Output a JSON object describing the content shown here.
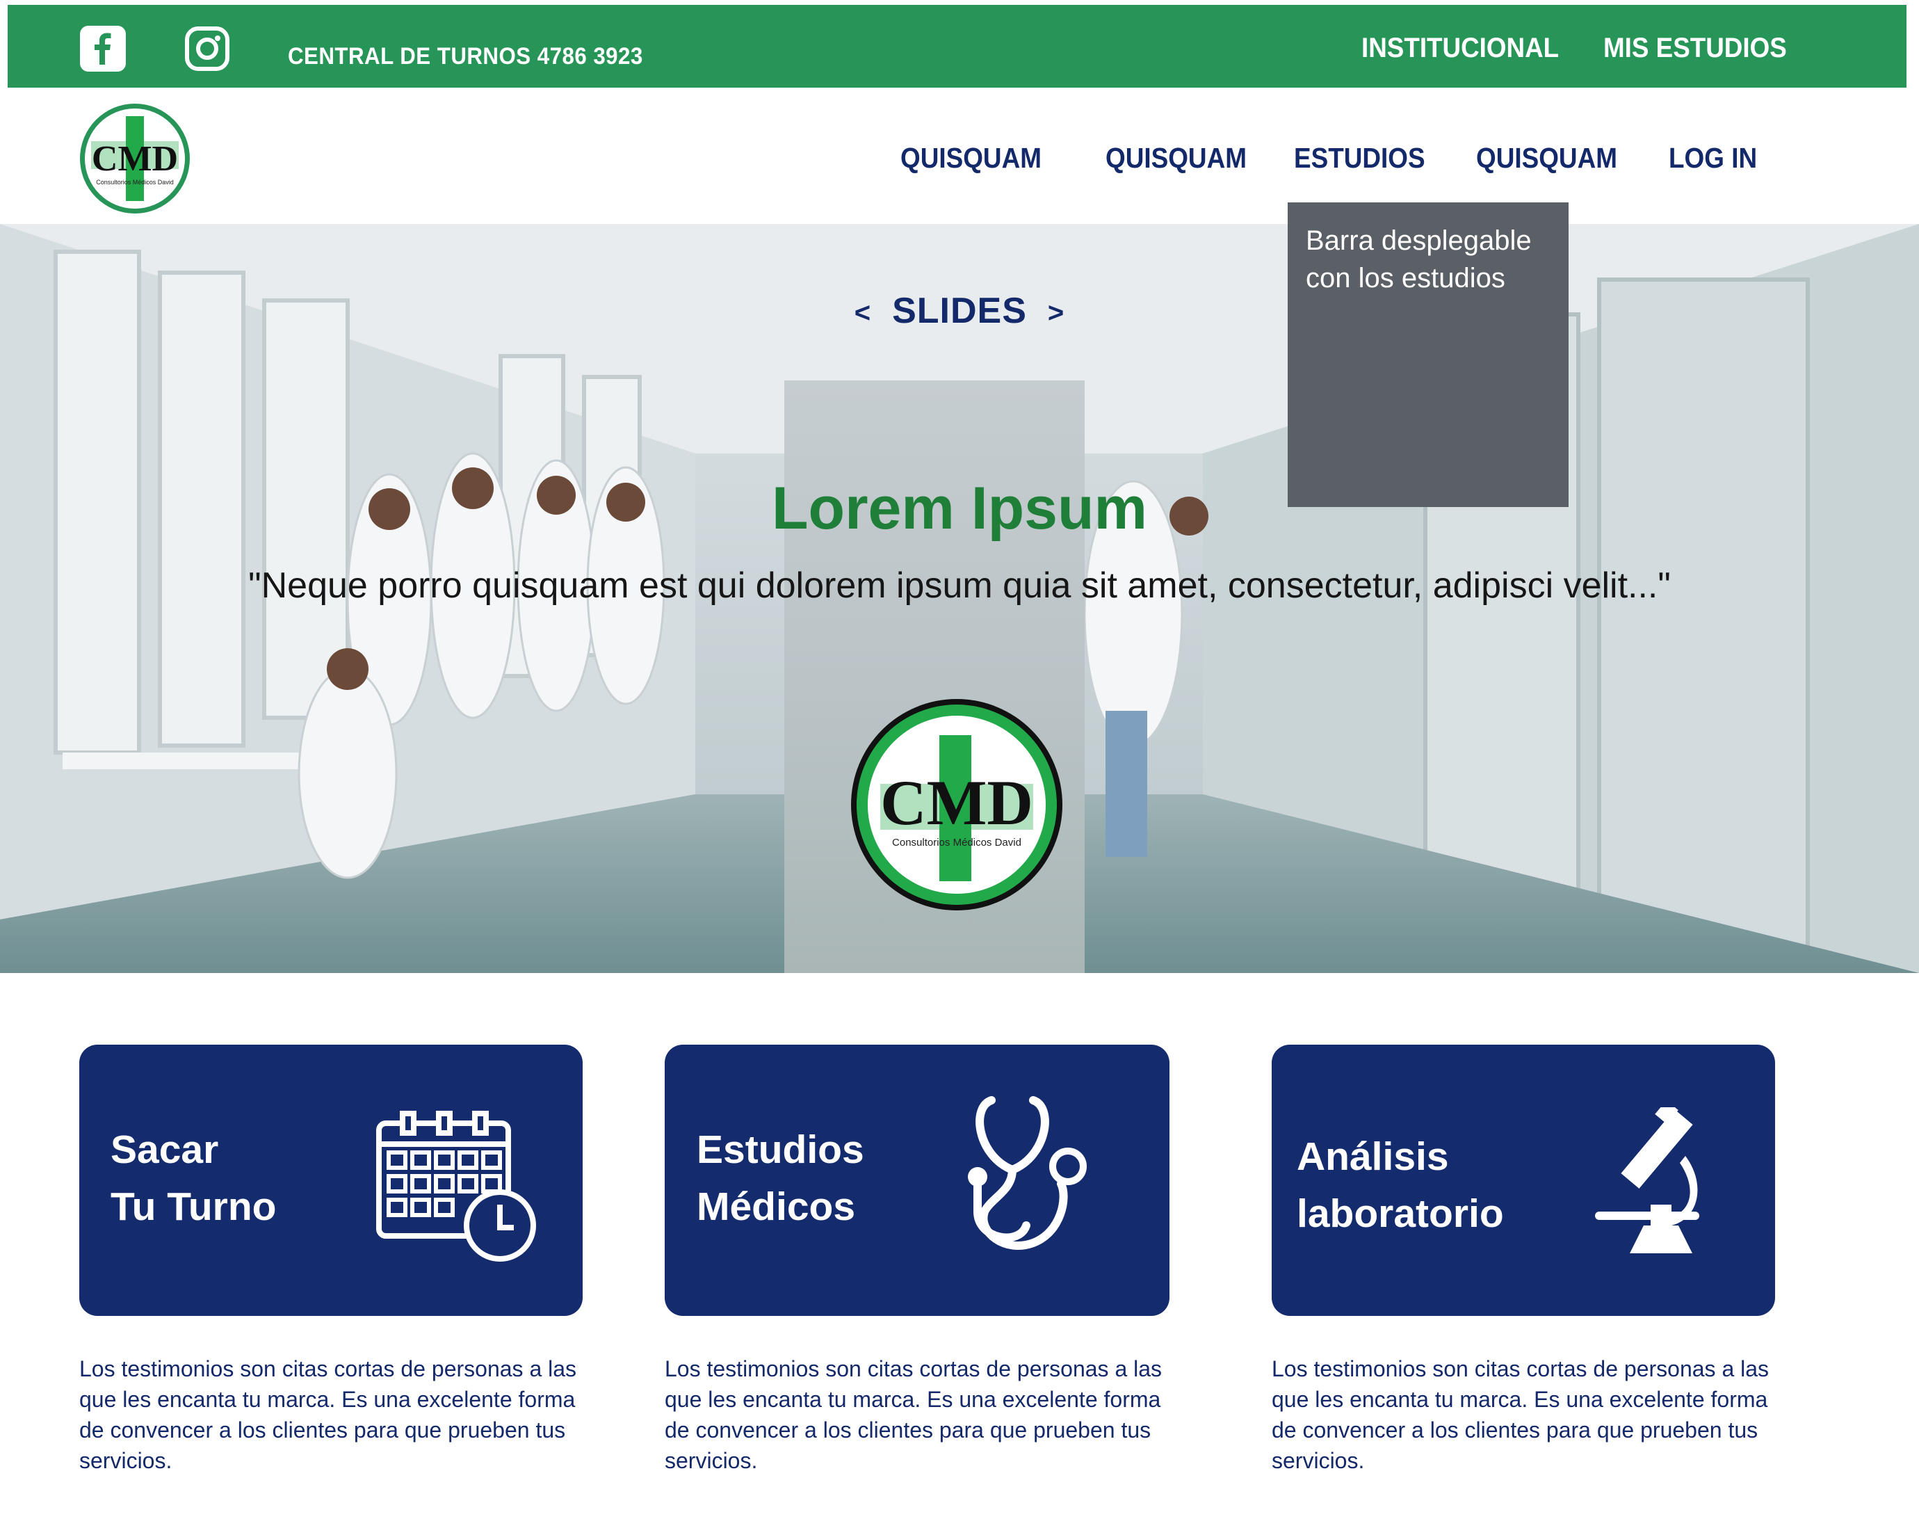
{
  "topbar": {
    "phone": "CENTRAL DE TURNOS 4786 3923",
    "links": [
      "INSTITUCIONAL",
      "MIS ESTUDIOS"
    ],
    "social": [
      "facebook-icon",
      "instagram-icon"
    ],
    "color": "#289558"
  },
  "logo": {
    "text": "CMD",
    "subtext": "Consultorios Médicos David"
  },
  "nav": {
    "items": [
      "QUISQUAM",
      "QUISQUAM",
      "ESTUDIOS",
      "QUISQUAM",
      "LOG IN"
    ],
    "color": "#14296a"
  },
  "dropdown": {
    "text": "Barra desplegable con los estudios"
  },
  "hero": {
    "slides_label": "SLIDES",
    "prev": "<",
    "next": ">",
    "title": "Lorem Ipsum",
    "quote": "\"Neque porro quisquam est qui dolorem ipsum quia  sit amet, consectetur, adipisci velit...\""
  },
  "cards": [
    {
      "line1": "Sacar",
      "line2": "Tu Turno",
      "icon": "calendar-clock-icon",
      "text": "Los testimonios son citas cortas de personas a las que les encanta tu marca. Es una excelente forma de convencer a los clientes para que prueben tus servicios."
    },
    {
      "line1": "Estudios",
      "line2": "Médicos",
      "icon": "stethoscope-icon",
      "text": "Los testimonios son citas cortas de personas a las que les encanta tu marca. Es una excelente forma de convencer a los clientes para que prueben tus servicios."
    },
    {
      "line1": "Análisis",
      "line2": "laboratorio",
      "icon": "microscope-icon",
      "text": "Los testimonios son citas cortas de personas a las que les encanta tu marca. Es una excelente forma de convencer a los clientes para que prueben tus servicios."
    }
  ],
  "colors": {
    "card_bg": "#142b6e",
    "accent_green": "#1f7f39"
  }
}
